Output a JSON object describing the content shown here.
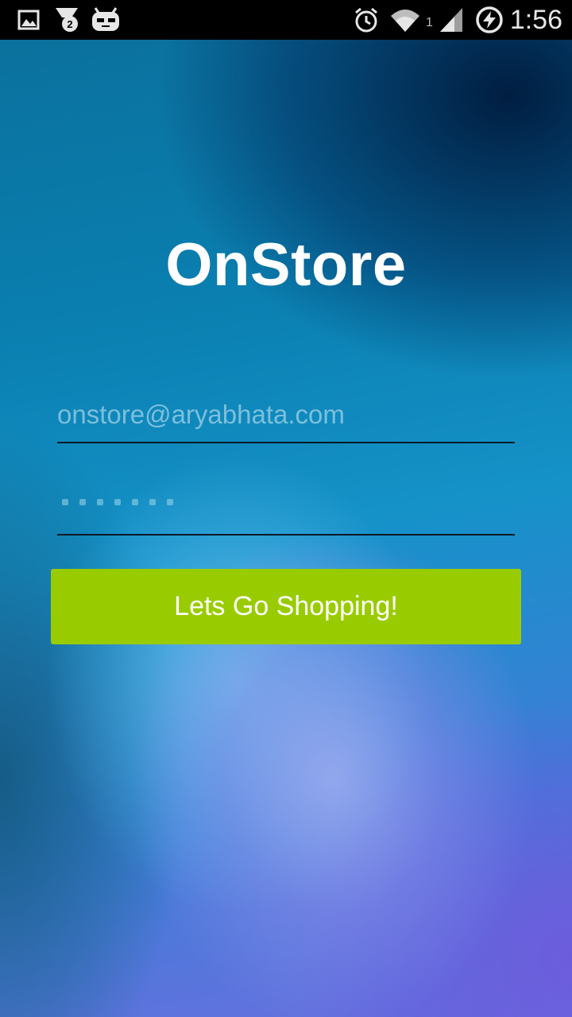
{
  "status_bar": {
    "time": "1:56",
    "notification_badge": "2",
    "signal_sub": "1",
    "icons": [
      "image-icon",
      "download-badge-icon",
      "android-head-icon",
      "alarm-icon",
      "wifi-icon",
      "cell-signal-icon",
      "battery-charging-icon"
    ]
  },
  "app": {
    "title": "OnStore"
  },
  "login": {
    "email_placeholder": "onstore@aryabhata.com",
    "password_mask_length": 7,
    "submit_label": "Lets Go Shopping!"
  },
  "colors": {
    "button": "#99cc00",
    "title": "#ffffff",
    "status_bar": "#000000"
  }
}
